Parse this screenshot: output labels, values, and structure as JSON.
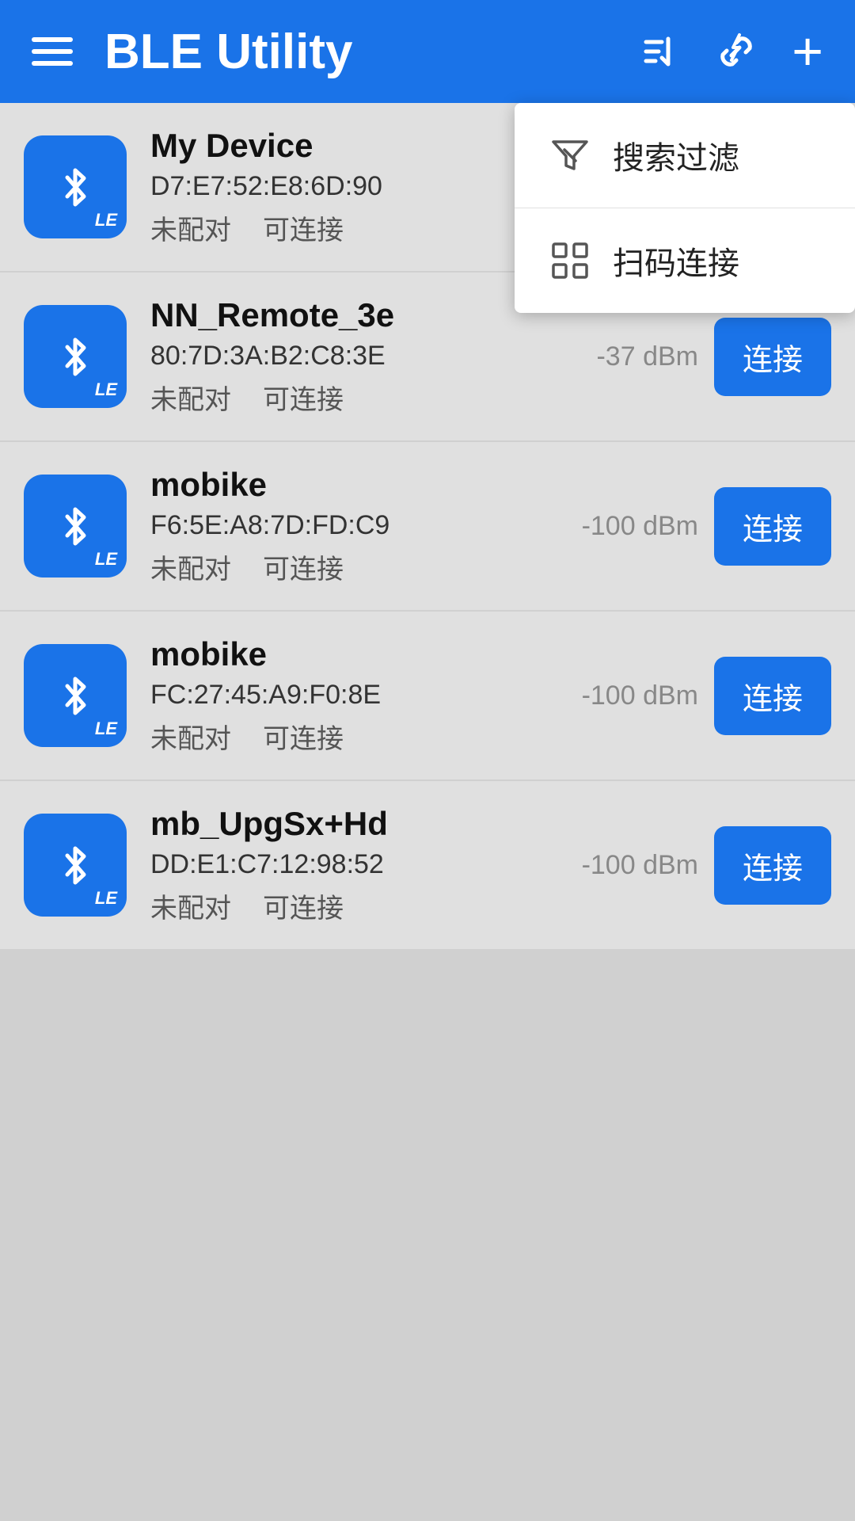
{
  "header": {
    "title": "BLE Utility",
    "menu_icon": "menu-icon",
    "sort_icon": "sort-icon",
    "link_icon": "link-icon",
    "add_icon": "add-icon"
  },
  "dropdown": {
    "items": [
      {
        "id": "filter",
        "label": "搜索过滤",
        "icon": "filter-icon"
      },
      {
        "id": "scan",
        "label": "扫码连接",
        "icon": "scan-icon"
      }
    ]
  },
  "devices": [
    {
      "name": "My Device",
      "mac": "D7:E7:52:E8:6D:90",
      "paired": "未配对",
      "connectable": "可连接",
      "signal": "",
      "show_connect": false
    },
    {
      "name": "NN_Remote_3e",
      "mac": "80:7D:3A:B2:C8:3E",
      "paired": "未配对",
      "connectable": "可连接",
      "signal": "-37 dBm",
      "show_connect": true,
      "connect_label": "连接"
    },
    {
      "name": "mobike",
      "mac": "F6:5E:A8:7D:FD:C9",
      "paired": "未配对",
      "connectable": "可连接",
      "signal": "-100 dBm",
      "show_connect": true,
      "connect_label": "连接"
    },
    {
      "name": "mobike",
      "mac": "FC:27:45:A9:F0:8E",
      "paired": "未配对",
      "connectable": "可连接",
      "signal": "-100 dBm",
      "show_connect": true,
      "connect_label": "连接"
    },
    {
      "name": "mb_UpgSx+Hd",
      "mac": "DD:E1:C7:12:98:52",
      "paired": "未配对",
      "connectable": "可连接",
      "signal": "-100 dBm",
      "show_connect": true,
      "connect_label": "连接"
    }
  ],
  "colors": {
    "blue": "#1a73e8",
    "background": "#d0d0d0",
    "item_bg": "#e0e0e0"
  }
}
